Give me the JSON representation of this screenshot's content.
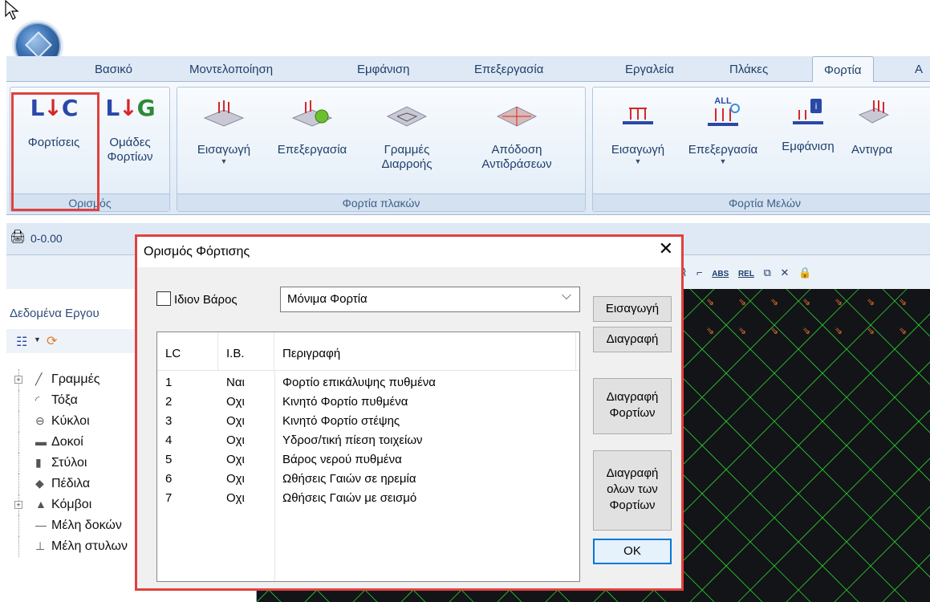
{
  "ribbon_tabs": [
    "Βασικό",
    "Μοντελοποίηση",
    "Εμφάνιση",
    "Επεξεργασία",
    "Εργαλεία",
    "Πλάκες",
    "Φορτία"
  ],
  "ribbon": {
    "define_group": {
      "label": "Ορισμός",
      "loadings_button": "Φορτίσεις",
      "load_groups_button_line1": "Ομάδες",
      "load_groups_button_line2": "Φορτίων"
    },
    "slab_loads_group": {
      "label": "Φορτία πλακών",
      "insert_button": "Εισαγωγή",
      "edit_button": "Επεξεργασία",
      "yield_lines_button_line1": "Γραμμές",
      "yield_lines_button_line2": "Διαρροής",
      "reactions_button_line1": "Απόδοση",
      "reactions_button_line2": "Αντιδράσεων"
    },
    "member_loads_group": {
      "label": "Φορτία Μελών",
      "insert_button": "Εισαγωγή",
      "edit_button": "Επεξεργασία",
      "display_button": "Εμφάνιση",
      "copy_button": "Αντιγρα",
      "all_badge": "ALL"
    }
  },
  "toolbar": {
    "coordinate": "0-0.00"
  },
  "view_tools": {
    "abs": "ABS",
    "rel": "REL"
  },
  "project_panel": {
    "title": "Δεδομένα Εργου",
    "tree": [
      {
        "label": "Γραμμές",
        "icon": "line-icon",
        "expandable": true
      },
      {
        "label": "Τόξα",
        "icon": "arc-icon",
        "expandable": false
      },
      {
        "label": "Κύκλοι",
        "icon": "circle-icon",
        "expandable": false
      },
      {
        "label": "Δοκοί",
        "icon": "beam-icon",
        "expandable": false
      },
      {
        "label": "Στύλοι",
        "icon": "column-icon",
        "expandable": false
      },
      {
        "label": "Πέδιλα",
        "icon": "footing-icon",
        "expandable": false
      },
      {
        "label": "Κόμβοι",
        "icon": "node-icon",
        "expandable": true
      },
      {
        "label": "Μέλη δοκών",
        "icon": "beam-member-icon",
        "expandable": false
      },
      {
        "label": "Μέλη στυλων",
        "icon": "column-member-icon",
        "expandable": false
      }
    ]
  },
  "dialog": {
    "title": "Ορισμός Φόρτισης",
    "self_weight_label": "Ιδιον Βάρος",
    "self_weight_checked": false,
    "load_type_selected": "Μόνιμα Φορτία",
    "buttons": {
      "insert": "Εισαγωγή",
      "delete": "Διαγραφή",
      "delete_loads_line1": "Διαγραφή",
      "delete_loads_line2": "Φορτίων",
      "delete_all_line1": "Διαγραφή",
      "delete_all_line2": "ολων των",
      "delete_all_line3": "Φορτίων",
      "ok": "OK"
    },
    "table": {
      "headers": [
        "LC",
        "I.B.",
        "Περιγραφή"
      ],
      "rows": [
        {
          "lc": "1",
          "ib": "Ναι",
          "desc": "Φορτίο επικάλυψης πυθμένα"
        },
        {
          "lc": "2",
          "ib": "Οχι",
          "desc": "Κινητό Φορτίο πυθμένα"
        },
        {
          "lc": "3",
          "ib": "Οχι",
          "desc": "Κινητό Φορτίο στέψης"
        },
        {
          "lc": "4",
          "ib": "Οχι",
          "desc": "Υδροσ/τική πίεση τοιχείων"
        },
        {
          "lc": "5",
          "ib": "Οχι",
          "desc": "Βάρος νερού πυθμένα"
        },
        {
          "lc": "6",
          "ib": "Οχι",
          "desc": "Ωθήσεις Γαιών σε ηρεμία"
        },
        {
          "lc": "7",
          "ib": "Οχι",
          "desc": "Ωθήσεις Γαιών με σεισμό"
        }
      ]
    }
  },
  "colors": {
    "highlight": "#e0413e",
    "ribbon_text": "#1e3f6b",
    "viewport_bg": "#121418",
    "grid_line": "#2fd02f",
    "load_arrow": "#e8732a"
  }
}
